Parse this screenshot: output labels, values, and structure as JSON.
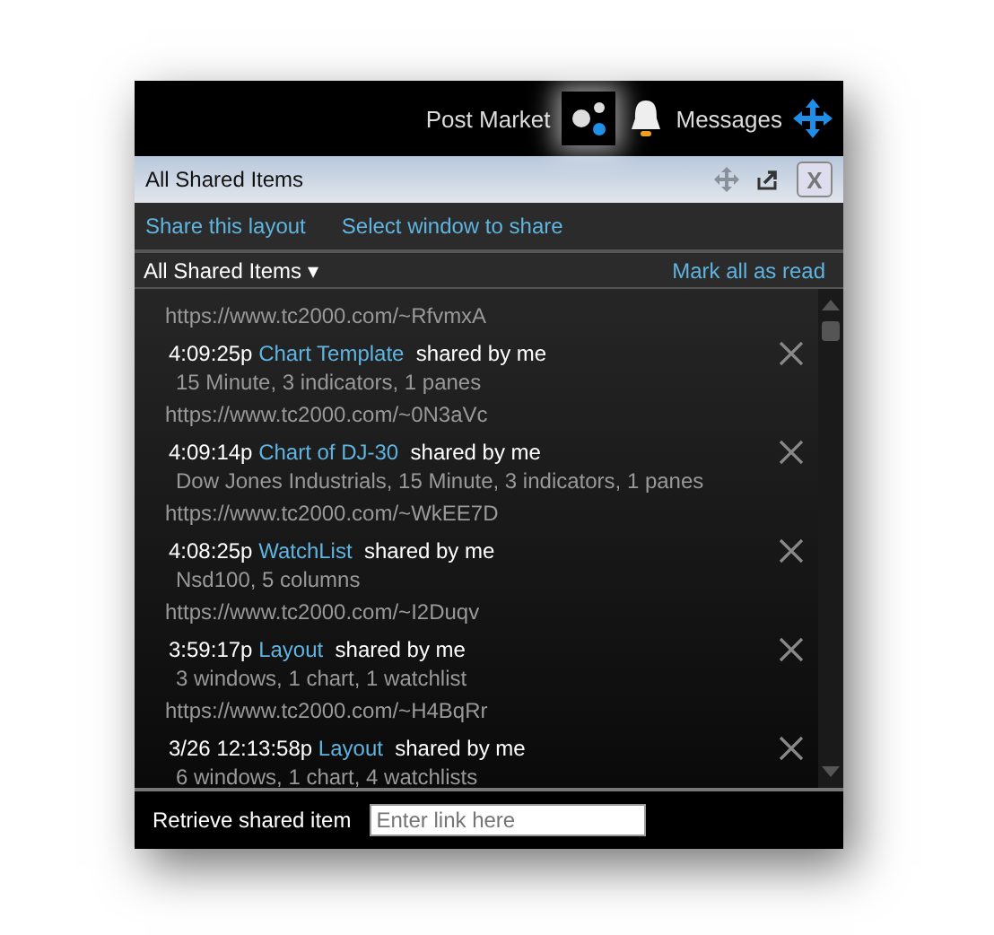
{
  "top_bar": {
    "status": "Post Market",
    "messages": "Messages"
  },
  "panel": {
    "title": "All Shared Items",
    "close": "X"
  },
  "actions": [
    "Share this layout",
    "Select window to share"
  ],
  "filter": {
    "label": "All Shared Items",
    "caret": "▾",
    "mark_all": "Mark all as read"
  },
  "leading_link": "https://www.tc2000.com/~RfvmxA",
  "items": [
    {
      "time": "4:09:25p",
      "item": "Chart Template",
      "by": "shared by me",
      "description": "15 Minute, 3 indicators, 1 panes",
      "link": "https://www.tc2000.com/~0N3aVc"
    },
    {
      "time": "4:09:14p",
      "item": "Chart of DJ-30",
      "by": "shared by me",
      "description": "Dow Jones Industrials, 15 Minute, 3 indicators, 1 panes",
      "link": "https://www.tc2000.com/~WkEE7D"
    },
    {
      "time": "4:08:25p",
      "item": "WatchList",
      "by": "shared by me",
      "description": "Nsd100, 5 columns",
      "link": "https://www.tc2000.com/~I2Duqv"
    },
    {
      "time": "3:59:17p",
      "item": "Layout",
      "by": "shared by me",
      "description": "3 windows, 1 chart, 1 watchlist",
      "link": "https://www.tc2000.com/~H4BqRr"
    },
    {
      "time": "3/26 12:13:58p",
      "item": "Layout",
      "by": "shared by me",
      "description": "6 windows, 1 chart, 4 watchlists"
    }
  ],
  "footer": {
    "label": "Retrieve shared item",
    "placeholder": "Enter link here"
  }
}
